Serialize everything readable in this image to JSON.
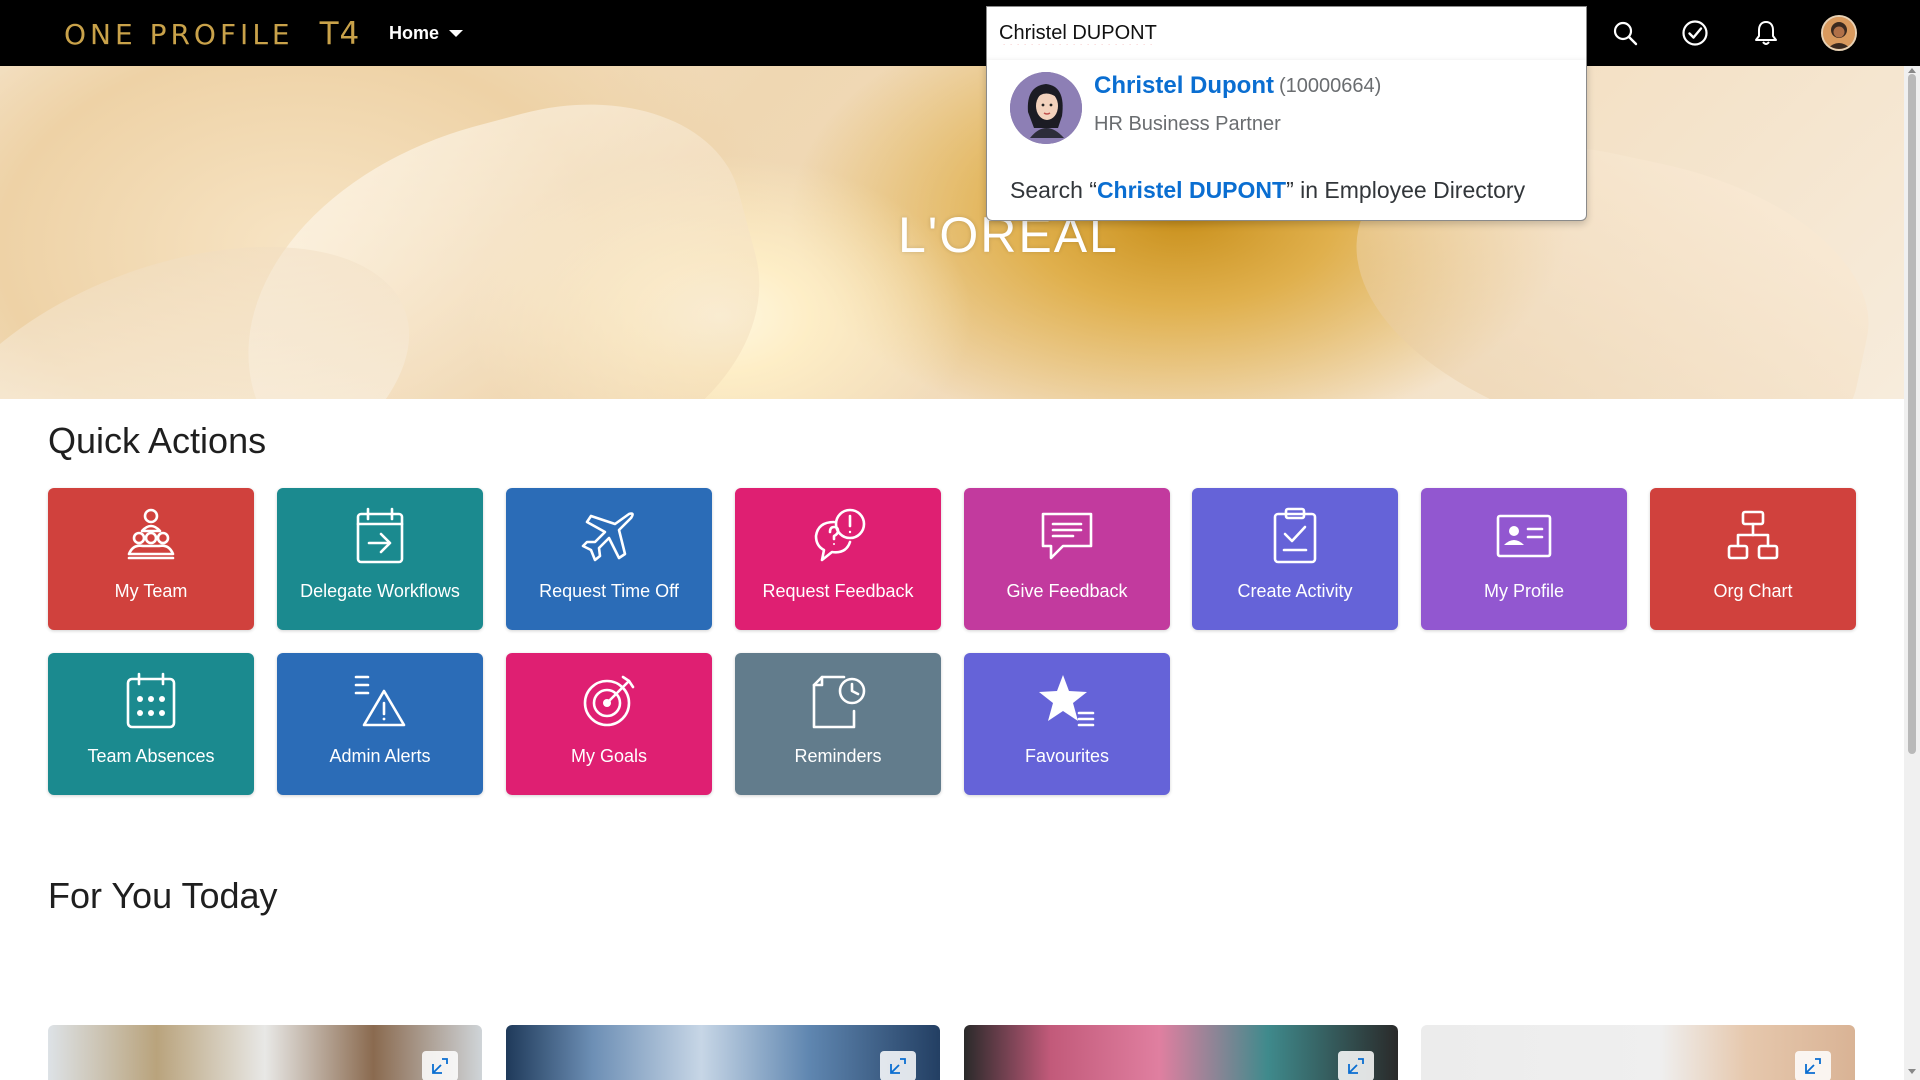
{
  "header": {
    "brand": "ONE PROFILE",
    "brand_suffix": "T4",
    "home_label": "Home",
    "search_value": "Christel DUPONT"
  },
  "search_dropdown": {
    "result_name": "Christel Dupont",
    "result_id": "(10000664)",
    "result_role": "HR Business Partner",
    "directory_prefix": "Search “",
    "directory_query": "Christel DUPONT",
    "directory_suffix": "” in Employee Directory"
  },
  "hero": {
    "logo": "L'ORÉAL"
  },
  "quick_actions": {
    "title": "Quick Actions",
    "tiles": [
      {
        "label": "My Team",
        "color": "#d0413d",
        "icon": "team-icon"
      },
      {
        "label": "Delegate Workflows",
        "color": "#1b8a8f",
        "icon": "calendar-forward-icon"
      },
      {
        "label": "Request Time Off",
        "color": "#2b6cb7",
        "icon": "airplane-icon"
      },
      {
        "label": "Request Feedback",
        "color": "#df1f72",
        "icon": "feedback-request-icon"
      },
      {
        "label": "Give Feedback",
        "color": "#c23a9e",
        "icon": "message-icon"
      },
      {
        "label": "Create Activity",
        "color": "#6563d8",
        "icon": "clipboard-check-icon"
      },
      {
        "label": "My Profile",
        "color": "#9257d0",
        "icon": "id-card-icon"
      },
      {
        "label": "Org Chart",
        "color": "#d0413d",
        "icon": "org-chart-icon"
      },
      {
        "label": "Team Absences",
        "color": "#1b8a8f",
        "icon": "calendar-grid-icon"
      },
      {
        "label": "Admin Alerts",
        "color": "#2b6cb7",
        "icon": "alert-list-icon"
      },
      {
        "label": "My Goals",
        "color": "#df1f72",
        "icon": "target-icon"
      },
      {
        "label": "Reminders",
        "color": "#627c8c",
        "icon": "reminder-icon"
      },
      {
        "label": "Favourites",
        "color": "#6563d8",
        "icon": "star-list-icon"
      }
    ]
  },
  "for_you_today": {
    "title": "For You Today"
  }
}
